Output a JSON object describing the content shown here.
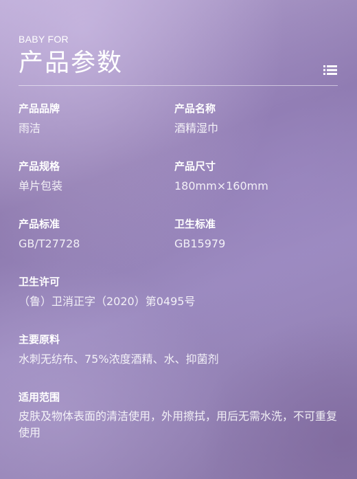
{
  "header": {
    "brand_tag": "BABY FOR",
    "title": "产品参数"
  },
  "menu_icon": "list-icon",
  "params": {
    "brand": {
      "label": "产品品牌",
      "value": "雨洁"
    },
    "name": {
      "label": "产品名称",
      "value": "酒精湿巾"
    },
    "spec": {
      "label": "产品规格",
      "value": "单片包装"
    },
    "size": {
      "label": "产品尺寸",
      "value": "180mm×160mm"
    },
    "standard": {
      "label": "产品标准",
      "value": "GB/T27728"
    },
    "hygiene_standard": {
      "label": "卫生标准",
      "value": "GB15979"
    },
    "license": {
      "label": "卫生许可",
      "value": "（鲁）卫消正字（2020）第0495号"
    },
    "materials": {
      "label": "主要原料",
      "value": "水刺无纺布、75%浓度酒精、水、抑菌剂"
    },
    "usage": {
      "label": "适用范围",
      "value": "皮肤及物体表面的清洁使用，外用擦拭，用后无需水洗，不可重复使用"
    }
  }
}
